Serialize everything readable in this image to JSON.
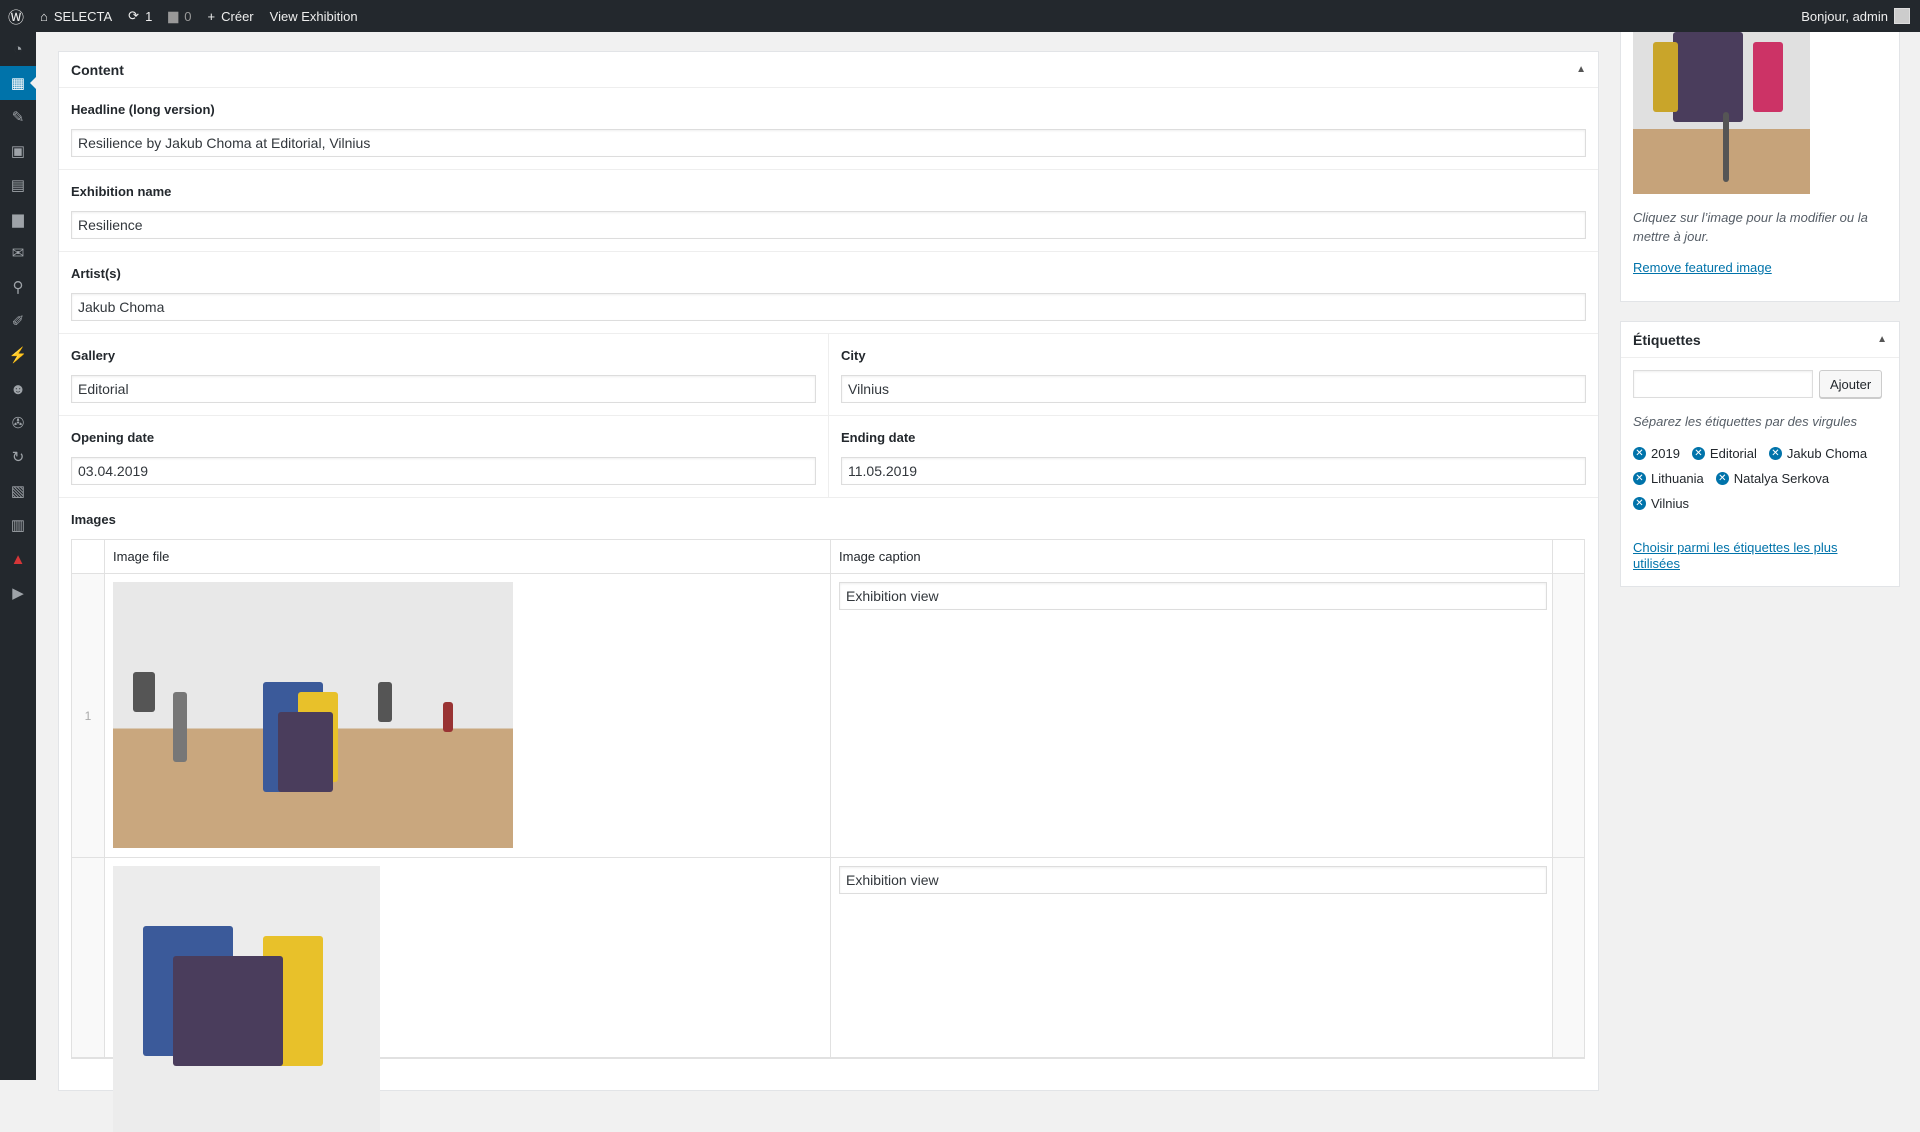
{
  "adminbar": {
    "site_name": "SELECTA",
    "updates_count": "1",
    "comments_count": "0",
    "new_label": "Créer",
    "view_label": "View Exhibition",
    "greeting": "Bonjour, admin"
  },
  "content": {
    "title": "Content",
    "headline_label": "Headline (long version)",
    "headline_value": "Resilience by Jakub Choma at Editorial, Vilnius",
    "exhibition_label": "Exhibition name",
    "exhibition_value": "Resilience",
    "artist_label": "Artist(s)",
    "artist_value": "Jakub Choma",
    "gallery_label": "Gallery",
    "gallery_value": "Editorial",
    "city_label": "City",
    "city_value": "Vilnius",
    "opening_label": "Opening date",
    "opening_value": "03.04.2019",
    "ending_label": "Ending date",
    "ending_value": "11.05.2019",
    "images_label": "Images",
    "col_image_file": "Image file",
    "col_image_caption": "Image caption",
    "rows": [
      {
        "index": "1",
        "caption": "Exhibition view"
      },
      {
        "index": "",
        "caption": "Exhibition view"
      }
    ]
  },
  "featured": {
    "hint": "Cliquez sur l’image pour la modifier ou la mettre à jour.",
    "remove_link": "Remove featured image"
  },
  "tags": {
    "title": "Étiquettes",
    "add_button": "Ajouter",
    "hint": "Séparez les étiquettes par des virgules",
    "items": [
      "2019",
      "Editorial",
      "Jakub Choma",
      "Lithuania",
      "Natalya Serkova",
      "Vilnius"
    ],
    "most_used_link": "Choisir parmi les étiquettes les plus utilisées"
  },
  "colors": {
    "accent": "#0073aa",
    "adminbar": "#23282d"
  }
}
